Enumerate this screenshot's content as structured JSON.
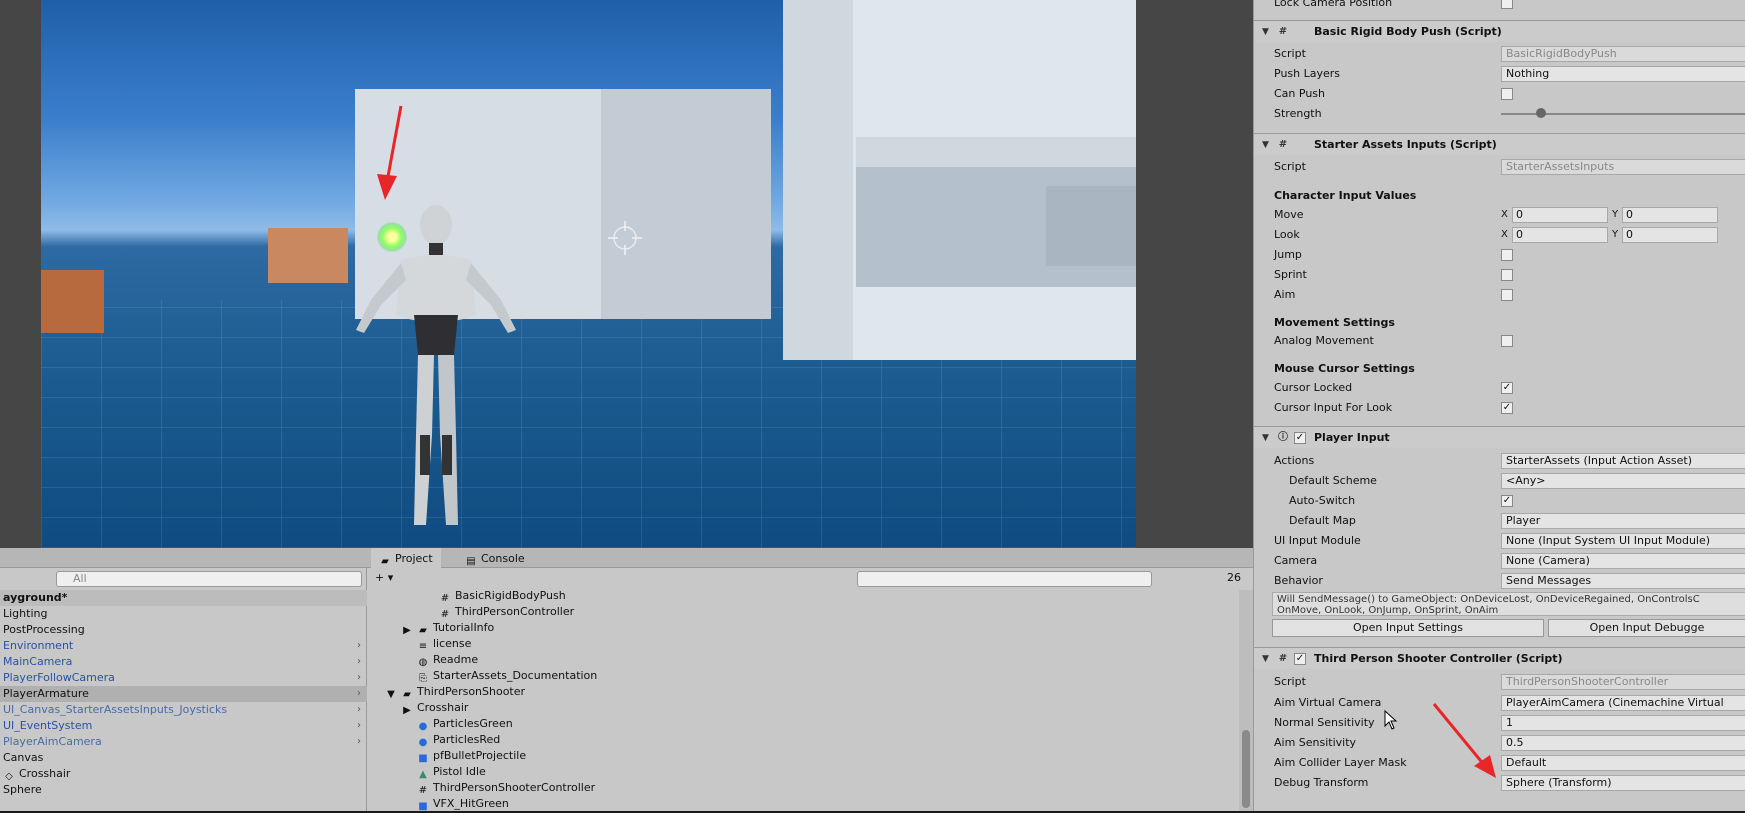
{
  "inspector": {
    "lock_camera_label": "Lock Camera Position",
    "brbp": {
      "title": "Basic Rigid Body Push (Script)",
      "script_label": "Script",
      "script_value": "BasicRigidBodyPush",
      "push_layers_label": "Push Layers",
      "push_layers_value": "Nothing",
      "can_push_label": "Can Push",
      "strength_label": "Strength"
    },
    "sai": {
      "title": "Starter Assets Inputs (Script)",
      "script_label": "Script",
      "script_value": "StarterAssetsInputs",
      "char_input_header": "Character Input Values",
      "move_label": "Move",
      "look_label": "Look",
      "x": "X",
      "y": "Y",
      "move_x": "0",
      "move_y": "0",
      "look_x": "0",
      "look_y": "0",
      "jump_label": "Jump",
      "sprint_label": "Sprint",
      "aim_label": "Aim",
      "movement_header": "Movement Settings",
      "analog_label": "Analog Movement",
      "mouse_header": "Mouse Cursor Settings",
      "cursor_locked_label": "Cursor Locked",
      "cursor_look_label": "Cursor Input For Look"
    },
    "pi": {
      "title": "Player Input",
      "actions_label": "Actions",
      "actions_value": "StarterAssets (Input Action Asset)",
      "default_scheme_label": "Default Scheme",
      "default_scheme_value": "<Any>",
      "auto_switch_label": "Auto-Switch",
      "default_map_label": "Default Map",
      "default_map_value": "Player",
      "ui_module_label": "UI Input Module",
      "ui_module_value": "None (Input System UI Input Module)",
      "camera_label": "Camera",
      "camera_value": "None (Camera)",
      "behavior_label": "Behavior",
      "behavior_value": "Send Messages",
      "note_line1": "Will SendMessage() to GameObject: OnDeviceLost, OnDeviceRegained, OnControlsC",
      "note_line2": "OnMove, OnLook, OnJump, OnSprint, OnAim",
      "open_settings": "Open Input Settings",
      "open_debugger": "Open Input Debugge"
    },
    "tpsc": {
      "title": "Third Person Shooter Controller (Script)",
      "script_label": "Script",
      "script_value": "ThirdPersonShooterController",
      "aim_cam_label": "Aim Virtual Camera",
      "aim_cam_value": "PlayerAimCamera (Cinemachine Virtual",
      "normal_sens_label": "Normal Sensitivity",
      "normal_sens_value": "1",
      "aim_sens_label": "Aim Sensitivity",
      "aim_sens_value": "0.5",
      "aim_mask_label": "Aim Collider Layer Mask",
      "aim_mask_value": "Default",
      "debug_label": "Debug Transform",
      "debug_value": "Sphere (Transform)"
    }
  },
  "hierarchy": {
    "search_placeholder": "All",
    "scene": "ayground*",
    "items": [
      {
        "label": "Lighting"
      },
      {
        "label": "PostProcessing"
      },
      {
        "label": "Environment"
      },
      {
        "label": "MainCamera"
      },
      {
        "label": "PlayerFollowCamera"
      },
      {
        "label": "PlayerArmature"
      },
      {
        "label": "UI_Canvas_StarterAssetsInputs_Joysticks"
      },
      {
        "label": "UI_EventSystem"
      },
      {
        "label": "PlayerAimCamera"
      },
      {
        "label": "Canvas"
      },
      {
        "label": "Crosshair"
      },
      {
        "label": "Sphere"
      }
    ]
  },
  "project": {
    "tab_project": "Project",
    "tab_console": "Console",
    "add_label": "+ ▾",
    "count": "26",
    "items": [
      {
        "label": "BasicRigidBodyPush"
      },
      {
        "label": "ThirdPersonController"
      },
      {
        "label": "TutorialInfo"
      },
      {
        "label": "license"
      },
      {
        "label": "Readme"
      },
      {
        "label": "StarterAssets_Documentation"
      },
      {
        "label": "ThirdPersonShooter"
      },
      {
        "label": "Crosshair"
      },
      {
        "label": "ParticlesGreen"
      },
      {
        "label": "ParticlesRed"
      },
      {
        "label": "pfBulletProjectile"
      },
      {
        "label": "Pistol Idle"
      },
      {
        "label": "ThirdPersonShooterController"
      },
      {
        "label": "VFX_HitGreen"
      }
    ]
  },
  "colors": {
    "arrow": "#e8262a",
    "selected_row": "#b0b0b0",
    "link_blue": "#2a4fa8"
  }
}
